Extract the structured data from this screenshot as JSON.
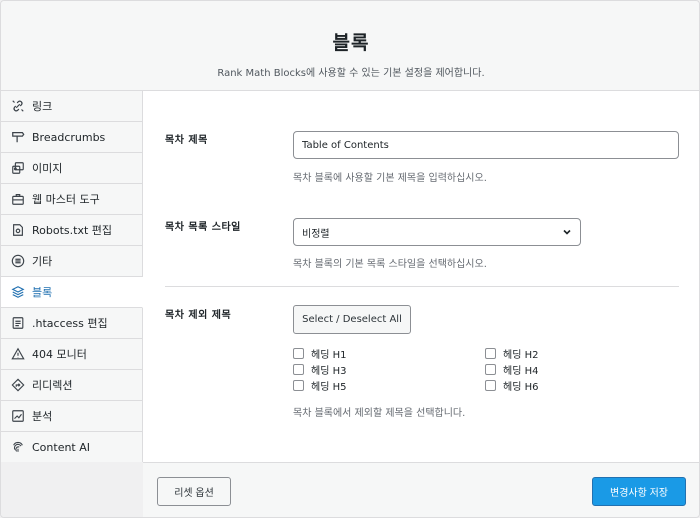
{
  "header": {
    "title": "블록",
    "subtitle": "Rank Math Blocks에 사용할 수 있는 기본 설정을 제어합니다."
  },
  "sidebar": {
    "items": [
      {
        "label": "링크",
        "icon": "link-icon"
      },
      {
        "label": "Breadcrumbs",
        "icon": "signpost-icon"
      },
      {
        "label": "이미지",
        "icon": "image-icon"
      },
      {
        "label": "웹 마스터 도구",
        "icon": "toolbox-icon"
      },
      {
        "label": "Robots.txt 편집",
        "icon": "robot-file-icon"
      },
      {
        "label": "기타",
        "icon": "list-circle-icon"
      },
      {
        "label": "블록",
        "icon": "blocks-icon"
      },
      {
        "label": ".htaccess 편집",
        "icon": "htaccess-file-icon"
      },
      {
        "label": "404 모니터",
        "icon": "warning-icon"
      },
      {
        "label": "리디렉션",
        "icon": "redirect-icon"
      },
      {
        "label": "분석",
        "icon": "analytics-icon"
      },
      {
        "label": "Content AI",
        "icon": "fingerprint-icon"
      }
    ],
    "active_index": 6
  },
  "form": {
    "toc_title": {
      "label": "목차 제목",
      "value": "Table of Contents",
      "desc": "목차 블록에 사용할 기본 제목을 입력하십시오."
    },
    "toc_list_style": {
      "label": "목차 목록 스타일",
      "value": "비정렬",
      "desc": "목차 블록의 기본 목록 스타일을 선택하십시오."
    },
    "toc_exclude": {
      "label": "목차 제외 제목",
      "button": "Select / Deselect All",
      "headings": [
        "헤딩 H1",
        "헤딩 H2",
        "헤딩 H3",
        "헤딩 H4",
        "헤딩 H5",
        "헤딩 H6"
      ],
      "checked": [
        false,
        false,
        false,
        false,
        false,
        false
      ],
      "desc": "목차 블록에서 제외할 제목을 선택합니다."
    }
  },
  "footer": {
    "reset_label": "리셋 옵션",
    "save_label": "변경사항 저장"
  },
  "colors": {
    "accent": "#2271b1",
    "save_button": "#1a9ae6",
    "border": "#dcdcde"
  }
}
